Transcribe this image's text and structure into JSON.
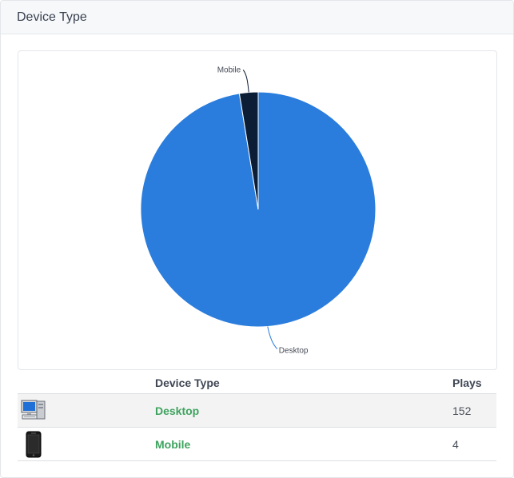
{
  "panel": {
    "title": "Device Type"
  },
  "chart_data": {
    "type": "pie",
    "categories": [
      "Desktop",
      "Mobile"
    ],
    "values": [
      152,
      4
    ],
    "colors": [
      "#2a7ddc",
      "#0c1d36"
    ],
    "start": "top",
    "direction": "clockwise"
  },
  "table": {
    "headers": {
      "device_type": "Device Type",
      "plays": "Plays"
    },
    "rows": [
      {
        "icon": "desktop-computer-icon",
        "device": "Desktop",
        "plays": "152"
      },
      {
        "icon": "mobile-phone-icon",
        "device": "Mobile",
        "plays": "4"
      }
    ]
  }
}
